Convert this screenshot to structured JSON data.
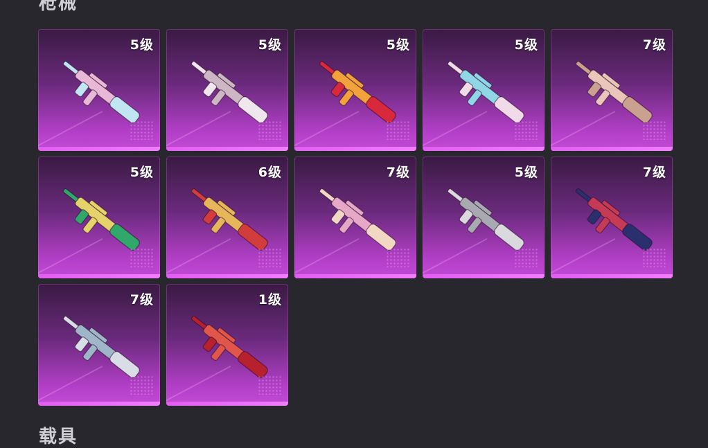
{
  "sections": {
    "top_title": "枪械",
    "bottom_title": "载具"
  },
  "items": [
    {
      "level": "5级",
      "icon": "rifle-skin-icon",
      "colors": [
        "#bfe6f2",
        "#e8b8d6"
      ]
    },
    {
      "level": "5级",
      "icon": "rifle-skin-icon",
      "colors": [
        "#f0e6ee",
        "#cdb7c4"
      ]
    },
    {
      "level": "5级",
      "icon": "rifle-skin-icon",
      "colors": [
        "#d8283c",
        "#f2a23a"
      ]
    },
    {
      "level": "5级",
      "icon": "rifle-skin-icon",
      "colors": [
        "#f2dbe8",
        "#8fd6e6"
      ]
    },
    {
      "level": "7级",
      "icon": "rifle-skin-icon",
      "colors": [
        "#caa08e",
        "#e9c6b9"
      ]
    },
    {
      "level": "5级",
      "icon": "rifle-skin-icon",
      "colors": [
        "#2fa86a",
        "#e5d26a"
      ]
    },
    {
      "level": "6级",
      "icon": "rifle-skin-icon",
      "colors": [
        "#d23c3c",
        "#e8b65a"
      ]
    },
    {
      "level": "7级",
      "icon": "rifle-skin-icon",
      "colors": [
        "#f1d7c4",
        "#e7a8c8"
      ]
    },
    {
      "level": "5级",
      "icon": "rifle-skin-icon",
      "colors": [
        "#d9d9de",
        "#a9a9b2"
      ]
    },
    {
      "level": "7级",
      "icon": "rifle-skin-icon",
      "colors": [
        "#2a2f6e",
        "#c53a55"
      ]
    },
    {
      "level": "7级",
      "icon": "rifle-skin-icon",
      "colors": [
        "#d8dde6",
        "#9fb6c8"
      ]
    },
    {
      "level": "1级",
      "icon": "rifle-skin-icon",
      "colors": [
        "#b7202d",
        "#e0564a"
      ]
    }
  ]
}
